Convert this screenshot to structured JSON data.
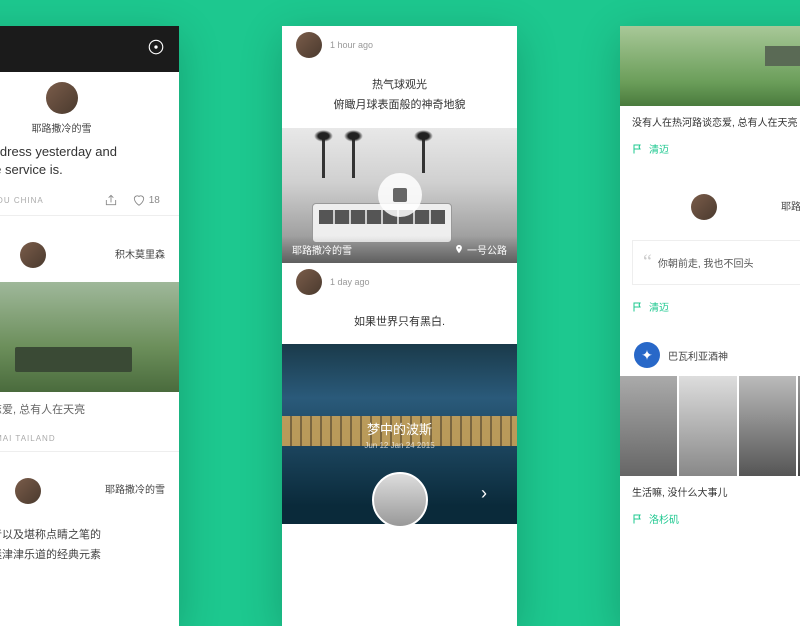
{
  "left": {
    "author1": "耶路撒冷的雪",
    "post_text_1": "ed this dress yesterday and",
    "post_text_2": "and the service is.",
    "location1": "CHENGDU CHINA",
    "like_count": "18",
    "author2": "积木莫里森",
    "caption2": "河路谈恋爱, 总有人在天亮",
    "location2": "CHIANGMAI TAILAND",
    "author3": "耶路撒冷的雪",
    "body3a": "吉他噪音以及堪称点睛之笔的",
    "body3b": "成为乐迷津津乐道的经典元素"
  },
  "center": {
    "time1": "1 hour ago",
    "text1a": "热气球观光",
    "text1b": "俯瞰月球表面般的神奇地貌",
    "photo1_author": "耶路撒冷的雪",
    "photo1_geo": "一号公路",
    "time2": "1 day ago",
    "text2": "如果世界只有黑白.",
    "hero_title": "梦中的波斯",
    "hero_date": "Jun 12 Jan 24 2015"
  },
  "right": {
    "card1_text": "没有人在热河路谈恋爱, 总有人在天亮",
    "tag1": "清迈",
    "author2": "耶路撒冷的雪",
    "quote2": "你朝前走, 我也不回头",
    "tag2": "清迈",
    "author3": "巴瓦利亚酒神",
    "card3_text": "生活嘛, 没什么大事儿",
    "tag3": "洛杉矶"
  }
}
